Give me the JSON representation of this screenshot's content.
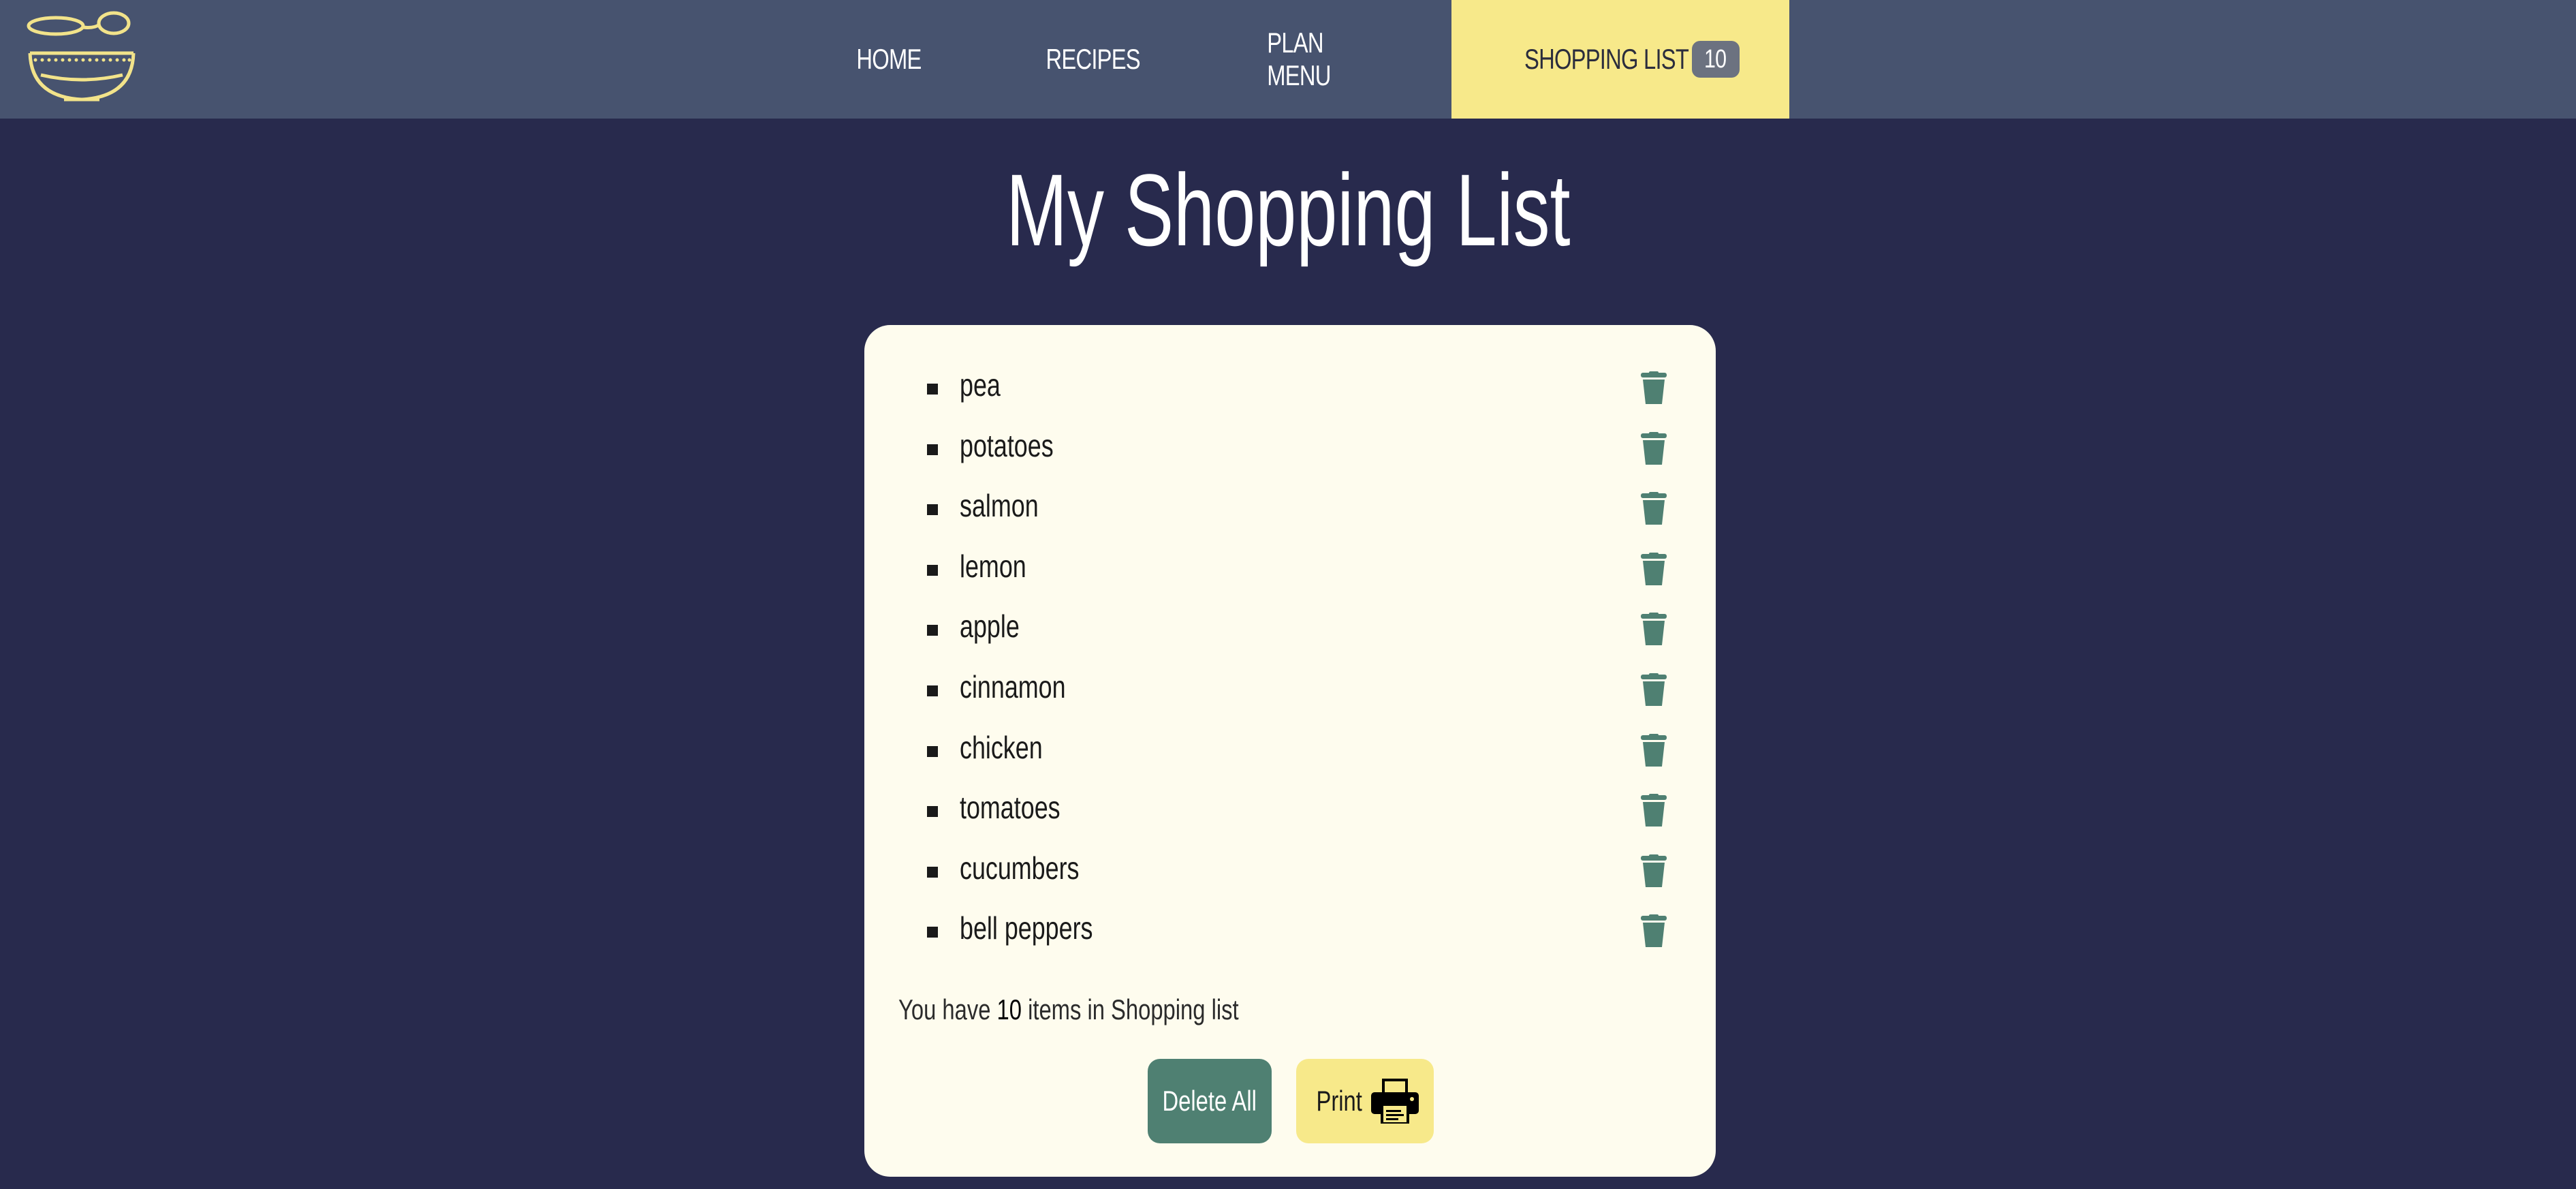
{
  "brand": {
    "logo_icon": "bowl-with-spoon-icon",
    "accent": "#f7e98a"
  },
  "nav": {
    "home": "HOME",
    "recipes": "RECIPES",
    "plan_menu": "PLAN MENU",
    "shopping_list": "SHOPPING LIST",
    "shopping_count": "10"
  },
  "page": {
    "title": "My Shopping List"
  },
  "shopping_list": {
    "items": [
      {
        "name": "pea"
      },
      {
        "name": "potatoes"
      },
      {
        "name": "salmon"
      },
      {
        "name": "lemon"
      },
      {
        "name": "apple"
      },
      {
        "name": "cinnamon"
      },
      {
        "name": "chicken"
      },
      {
        "name": "tomatoes"
      },
      {
        "name": "cucumbers"
      },
      {
        "name": "bell peppers"
      }
    ],
    "delete_icon": "trash-icon",
    "summary_prefix": "You have",
    "summary_count": "10",
    "summary_suffix": "items in Shopping list",
    "delete_all_label": "Delete All",
    "print_label": "Print",
    "print_icon": "printer-icon"
  },
  "colors": {
    "background": "#282a4d",
    "header": "#47536f",
    "card": "#fefcee",
    "active_tab": "#f7e98a",
    "delete_button": "#4f8072",
    "trash_icon": "#4f8072",
    "badge": "#6c7280"
  }
}
